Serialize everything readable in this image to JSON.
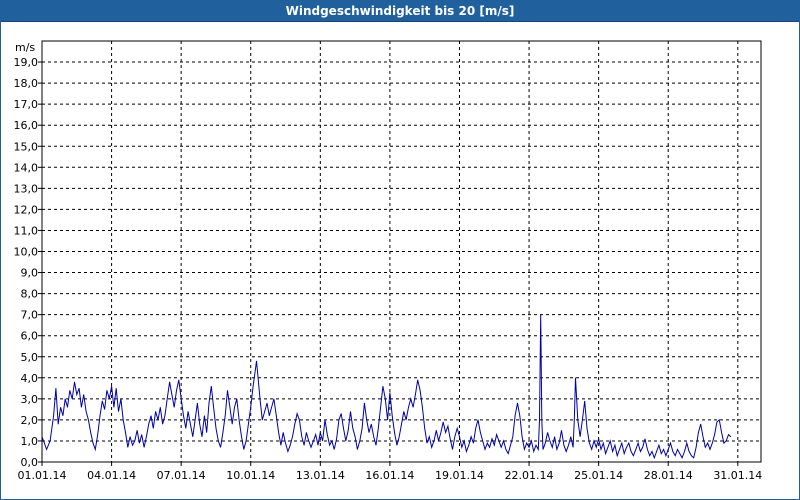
{
  "window": {
    "title": "Windgeschwindigkeit bis 20 [m/s]",
    "title_bar_color": "#20609c"
  },
  "chart_data": {
    "type": "line",
    "title": "Windgeschwindigkeit bis 20 [m/s]",
    "ylabel": "m/s",
    "xlabel": "",
    "ylim": [
      0,
      20
    ],
    "xlim": [
      "01.01.14",
      "01.02.14"
    ],
    "yticks": [
      "0,0",
      "1,0",
      "2,0",
      "3,0",
      "4,0",
      "5,0",
      "6,0",
      "7,0",
      "8,0",
      "9,0",
      "10,0",
      "11,0",
      "12,0",
      "13,0",
      "14,0",
      "15,0",
      "16,0",
      "17,0",
      "18,0",
      "19,0"
    ],
    "xticks": [
      "01.01.14",
      "04.01.14",
      "07.01.14",
      "10.01.14",
      "13.01.14",
      "16.01.14",
      "19.01.14",
      "22.01.14",
      "25.01.14",
      "28.01.14",
      "31.01.14"
    ],
    "grid": true,
    "grid_style": "dashed",
    "line_color": "#0000aa",
    "series": [
      {
        "points": [
          [
            0.0,
            1.2
          ],
          [
            0.2,
            0.6
          ],
          [
            0.35,
            1.0
          ],
          [
            0.5,
            2.2
          ],
          [
            0.6,
            3.5
          ],
          [
            0.7,
            1.8
          ],
          [
            0.8,
            2.6
          ],
          [
            0.9,
            2.2
          ],
          [
            1.0,
            3.0
          ],
          [
            1.1,
            2.6
          ],
          [
            1.2,
            3.4
          ],
          [
            1.3,
            3.0
          ],
          [
            1.4,
            3.8
          ],
          [
            1.5,
            3.2
          ],
          [
            1.6,
            3.5
          ],
          [
            1.7,
            2.6
          ],
          [
            1.8,
            3.2
          ],
          [
            1.9,
            2.4
          ],
          [
            2.0,
            2.0
          ],
          [
            2.1,
            1.4
          ],
          [
            2.2,
            0.9
          ],
          [
            2.3,
            0.6
          ],
          [
            2.4,
            1.3
          ],
          [
            2.5,
            2.2
          ],
          [
            2.6,
            2.9
          ],
          [
            2.7,
            2.5
          ],
          [
            2.8,
            3.4
          ],
          [
            2.9,
            3.0
          ],
          [
            3.0,
            3.6
          ],
          [
            3.1,
            2.6
          ],
          [
            3.2,
            3.5
          ],
          [
            3.3,
            2.4
          ],
          [
            3.4,
            3.0
          ],
          [
            3.5,
            2.0
          ],
          [
            3.6,
            1.4
          ],
          [
            3.7,
            0.7
          ],
          [
            3.8,
            1.2
          ],
          [
            3.9,
            0.8
          ],
          [
            4.0,
            1.0
          ],
          [
            4.1,
            1.5
          ],
          [
            4.2,
            0.9
          ],
          [
            4.3,
            1.3
          ],
          [
            4.4,
            0.7
          ],
          [
            4.5,
            1.2
          ],
          [
            4.6,
            1.8
          ],
          [
            4.7,
            2.2
          ],
          [
            4.8,
            1.6
          ],
          [
            4.9,
            2.4
          ],
          [
            5.0,
            2.0
          ],
          [
            5.1,
            2.6
          ],
          [
            5.2,
            1.8
          ],
          [
            5.3,
            2.2
          ],
          [
            5.4,
            3.0
          ],
          [
            5.5,
            3.8
          ],
          [
            5.6,
            3.2
          ],
          [
            5.7,
            2.6
          ],
          [
            5.8,
            3.4
          ],
          [
            5.9,
            3.9
          ],
          [
            6.0,
            3.0
          ],
          [
            6.1,
            2.2
          ],
          [
            6.2,
            1.6
          ],
          [
            6.3,
            2.4
          ],
          [
            6.4,
            1.8
          ],
          [
            6.5,
            1.2
          ],
          [
            6.6,
            2.0
          ],
          [
            6.7,
            2.8
          ],
          [
            6.8,
            1.8
          ],
          [
            6.9,
            1.2
          ],
          [
            7.0,
            2.2
          ],
          [
            7.1,
            1.4
          ],
          [
            7.2,
            2.8
          ],
          [
            7.3,
            3.6
          ],
          [
            7.4,
            2.6
          ],
          [
            7.5,
            1.6
          ],
          [
            7.6,
            1.0
          ],
          [
            7.7,
            0.7
          ],
          [
            7.8,
            1.4
          ],
          [
            7.9,
            2.2
          ],
          [
            8.0,
            3.4
          ],
          [
            8.1,
            2.6
          ],
          [
            8.2,
            1.8
          ],
          [
            8.3,
            2.6
          ],
          [
            8.4,
            3.0
          ],
          [
            8.5,
            2.0
          ],
          [
            8.6,
            1.2
          ],
          [
            8.7,
            0.6
          ],
          [
            8.8,
            1.0
          ],
          [
            8.9,
            1.8
          ],
          [
            9.0,
            2.6
          ],
          [
            9.1,
            3.6
          ],
          [
            9.2,
            4.4
          ],
          [
            9.25,
            4.8
          ],
          [
            9.3,
            4.2
          ],
          [
            9.4,
            3.0
          ],
          [
            9.5,
            2.0
          ],
          [
            9.6,
            2.4
          ],
          [
            9.7,
            2.8
          ],
          [
            9.8,
            2.2
          ],
          [
            9.9,
            2.6
          ],
          [
            10.0,
            3.0
          ],
          [
            10.1,
            2.2
          ],
          [
            10.2,
            1.4
          ],
          [
            10.3,
            0.8
          ],
          [
            10.4,
            1.4
          ],
          [
            10.5,
            0.9
          ],
          [
            10.6,
            0.5
          ],
          [
            10.7,
            0.8
          ],
          [
            10.8,
            1.2
          ],
          [
            10.9,
            1.8
          ],
          [
            11.0,
            2.3
          ],
          [
            11.1,
            2.0
          ],
          [
            11.2,
            1.2
          ],
          [
            11.3,
            0.8
          ],
          [
            11.4,
            1.4
          ],
          [
            11.5,
            1.0
          ],
          [
            11.6,
            0.7
          ],
          [
            11.7,
            1.0
          ],
          [
            11.8,
            1.3
          ],
          [
            11.9,
            0.8
          ],
          [
            12.0,
            1.4
          ],
          [
            12.1,
            1.0
          ],
          [
            12.2,
            2.0
          ],
          [
            12.3,
            1.3
          ],
          [
            12.4,
            0.8
          ],
          [
            12.5,
            1.0
          ],
          [
            12.6,
            0.6
          ],
          [
            12.7,
            1.1
          ],
          [
            12.8,
            2.0
          ],
          [
            12.9,
            2.3
          ],
          [
            13.0,
            1.6
          ],
          [
            13.1,
            1.0
          ],
          [
            13.2,
            1.5
          ],
          [
            13.3,
            2.4
          ],
          [
            13.4,
            1.6
          ],
          [
            13.5,
            1.2
          ],
          [
            13.6,
            0.6
          ],
          [
            13.7,
            1.0
          ],
          [
            13.8,
            1.6
          ],
          [
            13.9,
            2.8
          ],
          [
            14.0,
            2.0
          ],
          [
            14.1,
            1.4
          ],
          [
            14.2,
            1.8
          ],
          [
            14.3,
            1.2
          ],
          [
            14.4,
            0.8
          ],
          [
            14.5,
            1.6
          ],
          [
            14.6,
            2.6
          ],
          [
            14.7,
            3.6
          ],
          [
            14.8,
            3.0
          ],
          [
            14.9,
            2.0
          ],
          [
            15.0,
            3.3
          ],
          [
            15.1,
            2.2
          ],
          [
            15.2,
            1.4
          ],
          [
            15.3,
            0.8
          ],
          [
            15.4,
            1.2
          ],
          [
            15.5,
            1.8
          ],
          [
            15.6,
            2.4
          ],
          [
            15.7,
            2.0
          ],
          [
            15.8,
            2.6
          ],
          [
            15.9,
            3.0
          ],
          [
            16.0,
            2.6
          ],
          [
            16.1,
            3.2
          ],
          [
            16.2,
            3.9
          ],
          [
            16.3,
            3.4
          ],
          [
            16.4,
            2.6
          ],
          [
            16.5,
            1.6
          ],
          [
            16.6,
            0.9
          ],
          [
            16.7,
            1.2
          ],
          [
            16.8,
            0.7
          ],
          [
            16.9,
            1.0
          ],
          [
            17.0,
            1.5
          ],
          [
            17.1,
            1.0
          ],
          [
            17.2,
            1.4
          ],
          [
            17.3,
            1.9
          ],
          [
            17.4,
            1.4
          ],
          [
            17.5,
            1.7
          ],
          [
            17.6,
            1.1
          ],
          [
            17.7,
            0.6
          ],
          [
            17.8,
            1.2
          ],
          [
            17.9,
            1.6
          ],
          [
            18.0,
            1.2
          ],
          [
            18.1,
            0.7
          ],
          [
            18.2,
            1.0
          ],
          [
            18.3,
            0.5
          ],
          [
            18.4,
            0.8
          ],
          [
            18.5,
            1.2
          ],
          [
            18.6,
            0.9
          ],
          [
            18.7,
            1.6
          ],
          [
            18.8,
            2.0
          ],
          [
            18.9,
            1.4
          ],
          [
            19.0,
            1.0
          ],
          [
            19.1,
            0.6
          ],
          [
            19.2,
            0.9
          ],
          [
            19.3,
            0.7
          ],
          [
            19.4,
            1.1
          ],
          [
            19.5,
            0.8
          ],
          [
            19.6,
            1.3
          ],
          [
            19.7,
            1.0
          ],
          [
            19.8,
            0.7
          ],
          [
            19.9,
            1.0
          ],
          [
            20.0,
            0.6
          ],
          [
            20.1,
            0.4
          ],
          [
            20.2,
            0.8
          ],
          [
            20.3,
            1.2
          ],
          [
            20.4,
            2.2
          ],
          [
            20.5,
            2.8
          ],
          [
            20.6,
            2.2
          ],
          [
            20.7,
            1.2
          ],
          [
            20.8,
            0.6
          ],
          [
            20.9,
            0.9
          ],
          [
            21.0,
            0.7
          ],
          [
            21.1,
            1.0
          ],
          [
            21.2,
            0.5
          ],
          [
            21.3,
            0.8
          ],
          [
            21.4,
            0.6
          ],
          [
            21.45,
            2.0
          ],
          [
            21.5,
            7.0
          ],
          [
            21.55,
            2.0
          ],
          [
            21.6,
            0.6
          ],
          [
            21.7,
            0.9
          ],
          [
            21.8,
            1.4
          ],
          [
            21.9,
            1.0
          ],
          [
            22.0,
            0.7
          ],
          [
            22.1,
            1.2
          ],
          [
            22.2,
            0.6
          ],
          [
            22.3,
            0.9
          ],
          [
            22.4,
            1.5
          ],
          [
            22.5,
            0.8
          ],
          [
            22.6,
            0.5
          ],
          [
            22.7,
            0.8
          ],
          [
            22.8,
            1.2
          ],
          [
            22.9,
            0.7
          ],
          [
            22.95,
            2.0
          ],
          [
            23.0,
            4.0
          ],
          [
            23.1,
            2.0
          ],
          [
            23.2,
            1.2
          ],
          [
            23.3,
            2.0
          ],
          [
            23.4,
            2.9
          ],
          [
            23.5,
            1.6
          ],
          [
            23.6,
            0.9
          ],
          [
            23.7,
            0.6
          ],
          [
            23.8,
            1.0
          ],
          [
            23.9,
            0.7
          ],
          [
            24.0,
            1.1
          ],
          [
            24.1,
            0.6
          ],
          [
            24.2,
            0.9
          ],
          [
            24.3,
            0.4
          ],
          [
            24.4,
            0.7
          ],
          [
            24.5,
            1.0
          ],
          [
            24.6,
            0.5
          ],
          [
            24.7,
            0.8
          ],
          [
            24.8,
            0.3
          ],
          [
            24.9,
            0.6
          ],
          [
            25.0,
            0.9
          ],
          [
            25.1,
            0.4
          ],
          [
            25.2,
            0.7
          ],
          [
            25.3,
            0.9
          ],
          [
            25.4,
            0.5
          ],
          [
            25.5,
            0.3
          ],
          [
            25.6,
            0.6
          ],
          [
            25.7,
            0.9
          ],
          [
            25.8,
            0.5
          ],
          [
            25.9,
            0.7
          ],
          [
            26.0,
            1.1
          ],
          [
            26.1,
            0.6
          ],
          [
            26.2,
            0.3
          ],
          [
            26.3,
            0.5
          ],
          [
            26.4,
            0.2
          ],
          [
            26.5,
            0.5
          ],
          [
            26.6,
            0.8
          ],
          [
            26.7,
            0.4
          ],
          [
            26.8,
            0.6
          ],
          [
            26.9,
            0.3
          ],
          [
            27.0,
            0.6
          ],
          [
            27.1,
            0.9
          ],
          [
            27.2,
            0.5
          ],
          [
            27.3,
            0.3
          ],
          [
            27.4,
            0.6
          ],
          [
            27.5,
            0.4
          ],
          [
            27.6,
            0.2
          ],
          [
            27.7,
            0.5
          ],
          [
            27.8,
            0.9
          ],
          [
            27.9,
            0.5
          ],
          [
            28.0,
            0.3
          ],
          [
            28.1,
            0.2
          ],
          [
            28.2,
            0.7
          ],
          [
            28.3,
            1.4
          ],
          [
            28.4,
            1.8
          ],
          [
            28.5,
            1.2
          ],
          [
            28.6,
            0.7
          ],
          [
            28.7,
            0.9
          ],
          [
            28.8,
            0.6
          ],
          [
            28.9,
            0.9
          ],
          [
            29.0,
            1.3
          ],
          [
            29.1,
            1.9
          ],
          [
            29.2,
            2.0
          ],
          [
            29.3,
            1.4
          ],
          [
            29.4,
            0.9
          ],
          [
            29.5,
            1.0
          ],
          [
            29.6,
            1.3
          ],
          [
            29.7,
            1.2
          ]
        ]
      }
    ]
  }
}
